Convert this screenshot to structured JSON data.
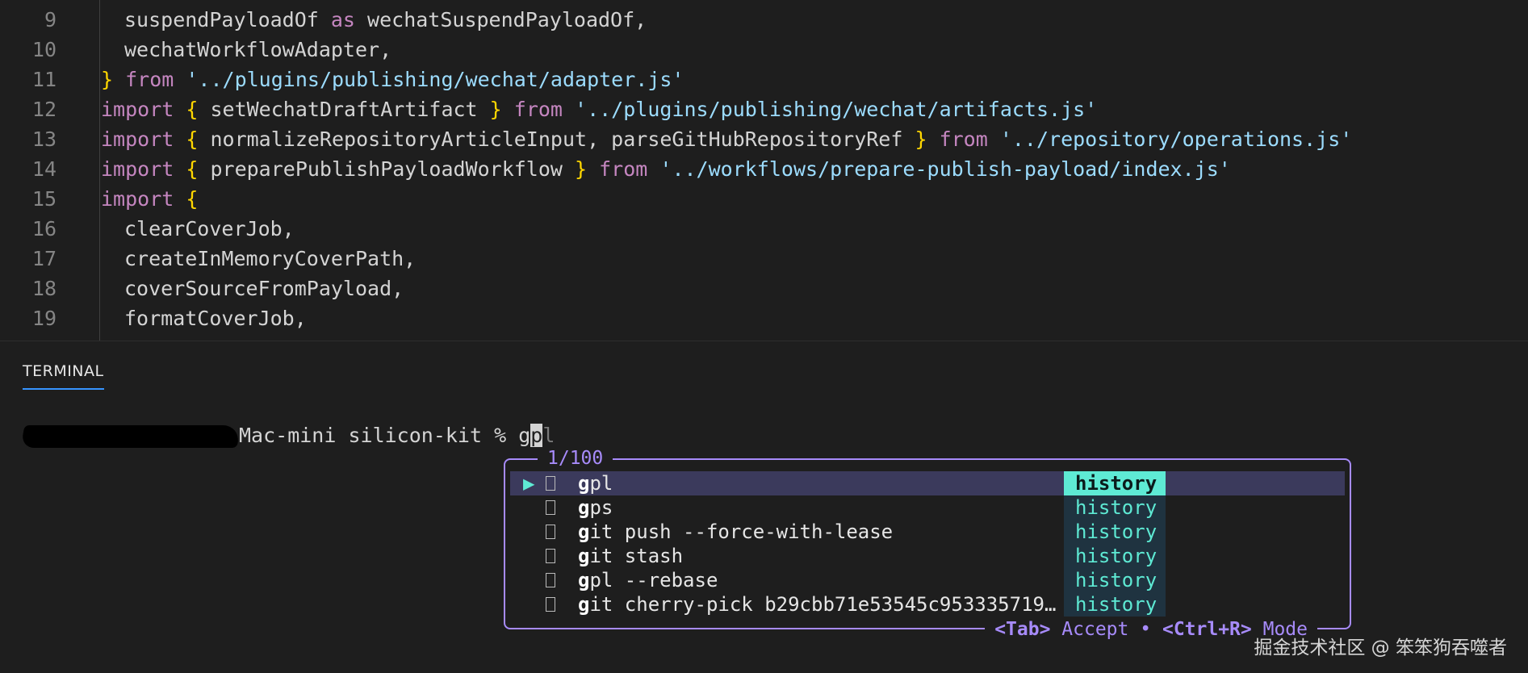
{
  "editor": {
    "lines": [
      {
        "no": "9",
        "indent": 1,
        "tokens": [
          {
            "t": "suspendPayloadOf ",
            "c": "id"
          },
          {
            "t": "as",
            "c": "kw"
          },
          {
            "t": " wechatSuspendPayloadOf,",
            "c": "id"
          }
        ]
      },
      {
        "no": "10",
        "indent": 1,
        "tokens": [
          {
            "t": "wechatWorkflowAdapter,",
            "c": "id"
          }
        ]
      },
      {
        "no": "11",
        "indent": 0,
        "tokens": [
          {
            "t": "}",
            "c": "br"
          },
          {
            "t": " from ",
            "c": "kw"
          },
          {
            "t": "'../plugins/publishing/wechat/adapter.js'",
            "c": "str"
          }
        ]
      },
      {
        "no": "12",
        "indent": 0,
        "tokens": [
          {
            "t": "import ",
            "c": "kw"
          },
          {
            "t": "{",
            "c": "br"
          },
          {
            "t": " setWechatDraftArtifact ",
            "c": "id"
          },
          {
            "t": "}",
            "c": "br"
          },
          {
            "t": " from ",
            "c": "kw"
          },
          {
            "t": "'../plugins/publishing/wechat/artifacts.js'",
            "c": "str"
          }
        ]
      },
      {
        "no": "13",
        "indent": 0,
        "tokens": [
          {
            "t": "import ",
            "c": "kw"
          },
          {
            "t": "{",
            "c": "br"
          },
          {
            "t": " normalizeRepositoryArticleInput, parseGitHubRepositoryRef ",
            "c": "id"
          },
          {
            "t": "}",
            "c": "br"
          },
          {
            "t": " from ",
            "c": "kw"
          },
          {
            "t": "'../repository/operations.js'",
            "c": "str"
          }
        ]
      },
      {
        "no": "14",
        "indent": 0,
        "tokens": [
          {
            "t": "import ",
            "c": "kw"
          },
          {
            "t": "{",
            "c": "br"
          },
          {
            "t": " preparePublishPayloadWorkflow ",
            "c": "id"
          },
          {
            "t": "}",
            "c": "br"
          },
          {
            "t": " from ",
            "c": "kw"
          },
          {
            "t": "'../workflows/prepare-publish-payload/index.js'",
            "c": "str"
          }
        ]
      },
      {
        "no": "15",
        "indent": 0,
        "tokens": [
          {
            "t": "import ",
            "c": "kw"
          },
          {
            "t": "{",
            "c": "br"
          }
        ]
      },
      {
        "no": "16",
        "indent": 1,
        "tokens": [
          {
            "t": "clearCoverJob,",
            "c": "id"
          }
        ]
      },
      {
        "no": "17",
        "indent": 1,
        "tokens": [
          {
            "t": "createInMemoryCoverPath,",
            "c": "id"
          }
        ]
      },
      {
        "no": "18",
        "indent": 1,
        "tokens": [
          {
            "t": "coverSourceFromPayload,",
            "c": "id"
          }
        ]
      },
      {
        "no": "19",
        "indent": 1,
        "tokens": [
          {
            "t": "formatCoverJob,",
            "c": "id"
          }
        ]
      }
    ]
  },
  "panel": {
    "tab_label": "TERMINAL"
  },
  "terminal": {
    "host_suffix": "Mac-mini silicon-kit % ",
    "typed_prefix": "g",
    "cursor_char": "p",
    "ghost_text": "l"
  },
  "completion": {
    "count": "1/100",
    "items": [
      {
        "prefix": "g",
        "rest": "pl",
        "source": "history",
        "selected": true
      },
      {
        "prefix": "g",
        "rest": "ps",
        "source": "history",
        "selected": false
      },
      {
        "prefix": "g",
        "rest": "it push --force-with-lease",
        "source": "history",
        "selected": false
      },
      {
        "prefix": "g",
        "rest": "it stash",
        "source": "history",
        "selected": false
      },
      {
        "prefix": "g",
        "rest": "pl --rebase",
        "source": "history",
        "selected": false
      },
      {
        "prefix": "g",
        "rest": "it cherry-pick b29cbb71e53545c953335719…",
        "source": "history",
        "selected": false
      }
    ],
    "selected_marker": "▶",
    "footer": {
      "accept_key": "<Tab>",
      "accept_label": "Accept",
      "separator": "•",
      "mode_key": "<Ctrl+R>",
      "mode_label": "Mode"
    }
  },
  "watermark": "掘金技术社区 @ 笨笨狗吞噬者",
  "colors": {
    "popup_border": "#a78bfa",
    "accent_teal": "#5eead4",
    "selected_row": "#3b3a5c"
  }
}
